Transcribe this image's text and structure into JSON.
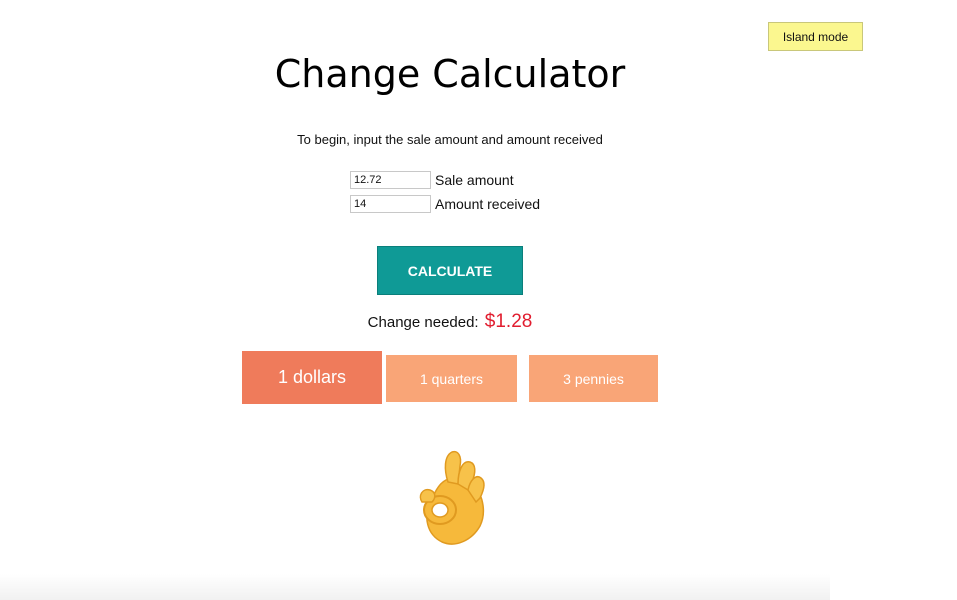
{
  "header": {
    "island_mode_label": "Island mode",
    "title": "Change Calculator",
    "instructions": "To begin, input the sale amount and amount received"
  },
  "form": {
    "sale_amount": {
      "value": "12.72",
      "label": "Sale amount"
    },
    "amount_received": {
      "value": "14",
      "label": "Amount received"
    },
    "calculate_label": "CALCULATE"
  },
  "result": {
    "change_label": "Change needed:",
    "change_amount": "$1.28",
    "denominations": [
      {
        "label": "1 dollars"
      },
      {
        "label": "1 quarters"
      },
      {
        "label": "3 pennies"
      }
    ]
  },
  "icons": {
    "result_icon": "ok-hand-icon"
  },
  "colors": {
    "calculate_button": "#0f9a96",
    "change_amount": "#e11d2f",
    "dollars_tile": "#ef7b5b",
    "coin_tile": "#f9a577",
    "island_button": "#fbf78f"
  }
}
